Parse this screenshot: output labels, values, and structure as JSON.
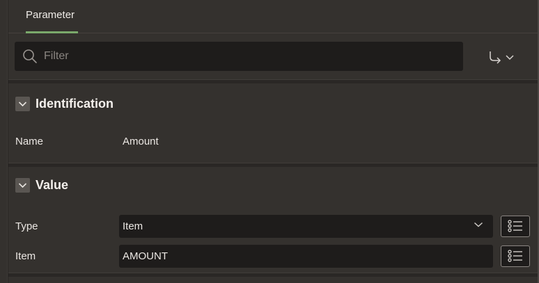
{
  "tabs": [
    {
      "label": "Parameter",
      "active": true
    }
  ],
  "filter": {
    "placeholder": "Filter",
    "value": ""
  },
  "sections": {
    "identification": {
      "title": "Identification",
      "name_label": "Name",
      "name_value": "Amount"
    },
    "value": {
      "title": "Value",
      "type_label": "Type",
      "type_value": "Item",
      "item_label": "Item",
      "item_value": "AMOUNT"
    }
  },
  "colors": {
    "accent": "#7aa96b",
    "panel": "#34312e",
    "field": "#1e1c1b"
  },
  "icons": [
    "search-icon",
    "goto-arrow-icon",
    "chevron-down-icon",
    "list-icon"
  ]
}
